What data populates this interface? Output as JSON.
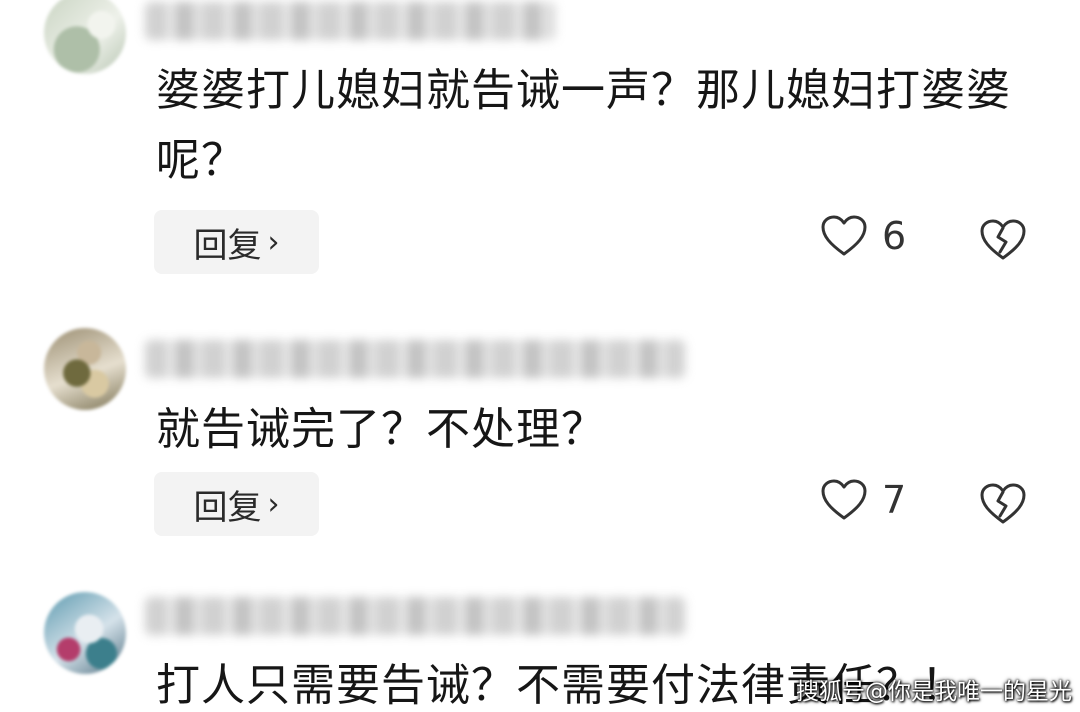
{
  "comments": [
    {
      "text": "婆婆打儿媳妇就告诫一声？那儿媳妇打婆婆呢？",
      "reply_label": "回复",
      "like_count": "6"
    },
    {
      "text": "就告诫完了？不处理？",
      "reply_label": "回复",
      "like_count": "7"
    },
    {
      "text": "打人只需要告诫？不需要付法律责任？！"
    }
  ],
  "icons": {
    "reply_chevron": "chevron-right-icon",
    "like": "heart-outline-icon",
    "dislike": "broken-heart-icon"
  },
  "watermark": {
    "text": "搜狐号@你是我唯一的星光"
  },
  "colors": {
    "background": "#ffffff",
    "text": "#161616",
    "reply_button_bg": "#f3f3f3",
    "icon_stroke": "#333333"
  }
}
